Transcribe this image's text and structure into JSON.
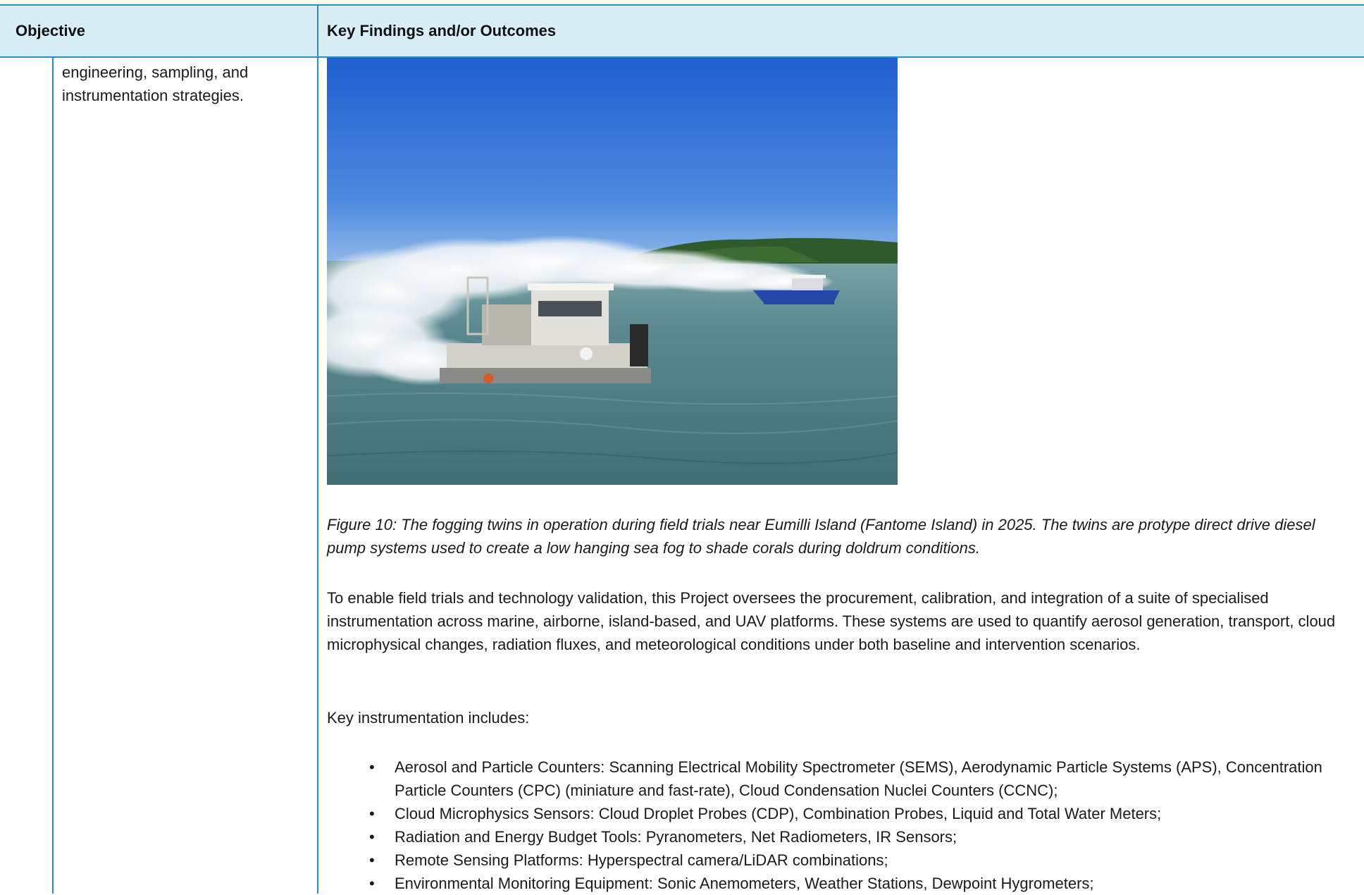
{
  "table": {
    "header": {
      "objective": "Objective",
      "findings": "Key Findings and/or Outcomes"
    }
  },
  "objective": {
    "text": "engineering, sampling, and instrumentation strategies."
  },
  "figure": {
    "caption": "Figure 10: The fogging twins in operation during field trials near Eumilli Island (Fantome Island) in 2025. The twins are protype direct drive diesel pump systems used to create a low hanging sea fog to shade corals during doldrum conditions."
  },
  "body": {
    "paragraph": "To enable field trials and technology validation, this Project oversees the procurement, calibration, and integration of a suite of specialised instrumentation across marine, airborne, island-based, and UAV platforms. These systems are used to quantify aerosol generation, transport, cloud microphysical changes, radiation fluxes, and meteorological conditions under both baseline and intervention scenarios.",
    "intro": "Key instrumentation includes:",
    "bullet_glyph": "•",
    "bullets": [
      "Aerosol and Particle Counters: Scanning Electrical Mobility Spectrometer (SEMS), Aerodynamic Particle Systems (APS), Concentration Particle Counters (CPC) (miniature and fast-rate), Cloud Condensation Nuclei Counters (CCNC);",
      "Cloud Microphysics Sensors: Cloud Droplet Probes (CDP), Combination Probes, Liquid and Total Water Meters;",
      "Radiation and Energy Budget Tools: Pyranometers, Net Radiometers, IR Sensors;",
      "Remote Sensing Platforms: Hyperspectral camera/LiDAR combinations;",
      "Environmental Monitoring Equipment: Sonic Anemometers, Weather Stations, Dewpoint Hygrometers;"
    ]
  },
  "colors": {
    "header_bg": "#d8eef6",
    "rule": "#2d8fc1",
    "sky": "#2d6fd6",
    "sea": "#4a7f86"
  }
}
